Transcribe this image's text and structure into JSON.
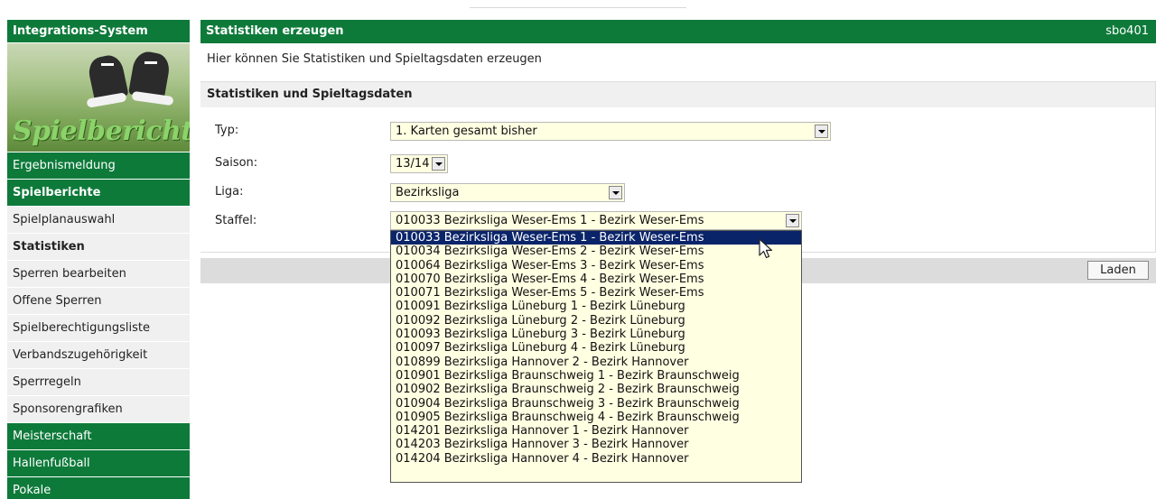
{
  "sidebar": {
    "title": "Integrations-System",
    "logo_text": "Spielbericht",
    "items": [
      {
        "label": "Ergebnismeldung",
        "style": "green"
      },
      {
        "label": "Spielberichte",
        "style": "green-bold"
      },
      {
        "label": "Spielplanauswahl",
        "style": "grey"
      },
      {
        "label": "Statistiken",
        "style": "grey-active"
      },
      {
        "label": "Sperren bearbeiten",
        "style": "grey"
      },
      {
        "label": "Offene Sperren",
        "style": "grey"
      },
      {
        "label": "Spielberechtigungsliste",
        "style": "grey"
      },
      {
        "label": "Verbandszugehörigkeit",
        "style": "grey"
      },
      {
        "label": "Sperrregeln",
        "style": "grey"
      },
      {
        "label": "Sponsorengrafiken",
        "style": "grey"
      },
      {
        "label": "Meisterschaft",
        "style": "green"
      },
      {
        "label": "Hallenfußball",
        "style": "green"
      },
      {
        "label": "Pokale",
        "style": "green"
      }
    ]
  },
  "header": {
    "title": "Statistiken erzeugen",
    "code": "sbo401"
  },
  "intro": "Hier können Sie Statistiken und Spieltagsdaten erzeugen",
  "panel": {
    "title": "Statistiken und Spieltagsdaten",
    "fields": {
      "typ": {
        "label": "Typ:",
        "value": "1. Karten gesamt bisher"
      },
      "saison": {
        "label": "Saison:",
        "value": "13/14"
      },
      "liga": {
        "label": "Liga:",
        "value": "Bezirksliga"
      },
      "staffel": {
        "label": "Staffel:",
        "value": "010033 Bezirksliga Weser-Ems 1 - Bezirk Weser-Ems"
      }
    }
  },
  "load_button": "Laden",
  "staffel_options": [
    "010033 Bezirksliga Weser-Ems 1 - Bezirk Weser-Ems",
    "010034 Bezirksliga Weser-Ems 2 - Bezirk Weser-Ems",
    "010064 Bezirksliga Weser-Ems 3 - Bezirk Weser-Ems",
    "010070 Bezirksliga Weser-Ems 4 - Bezirk Weser-Ems",
    "010071 Bezirksliga Weser-Ems 5 - Bezirk Weser-Ems",
    "010091 Bezirksliga Lüneburg 1 - Bezirk Lüneburg",
    "010092 Bezirksliga Lüneburg 2 - Bezirk Lüneburg",
    "010093 Bezirksliga Lüneburg 3 - Bezirk Lüneburg",
    "010097 Bezirksliga Lüneburg 4 - Bezirk Lüneburg",
    "010899 Bezirksliga Hannover 2 - Bezirk Hannover",
    "010901 Bezirksliga Braunschweig 1 - Bezirk Braunschweig",
    "010902 Bezirksliga Braunschweig 2 - Bezirk Braunschweig",
    "010904 Bezirksliga Braunschweig 3 - Bezirk Braunschweig",
    "010905 Bezirksliga Braunschweig 4 - Bezirk Braunschweig",
    "014201 Bezirksliga Hannover 1 - Bezirk Hannover",
    "014203 Bezirksliga Hannover 3 - Bezirk Hannover",
    "014204 Bezirksliga Hannover 4 - Bezirk Hannover"
  ],
  "selected_option_index": 0,
  "colors": {
    "brand_green": "#0e7a3a",
    "select_bg": "#ffffe2",
    "selection": "#0a246a"
  }
}
